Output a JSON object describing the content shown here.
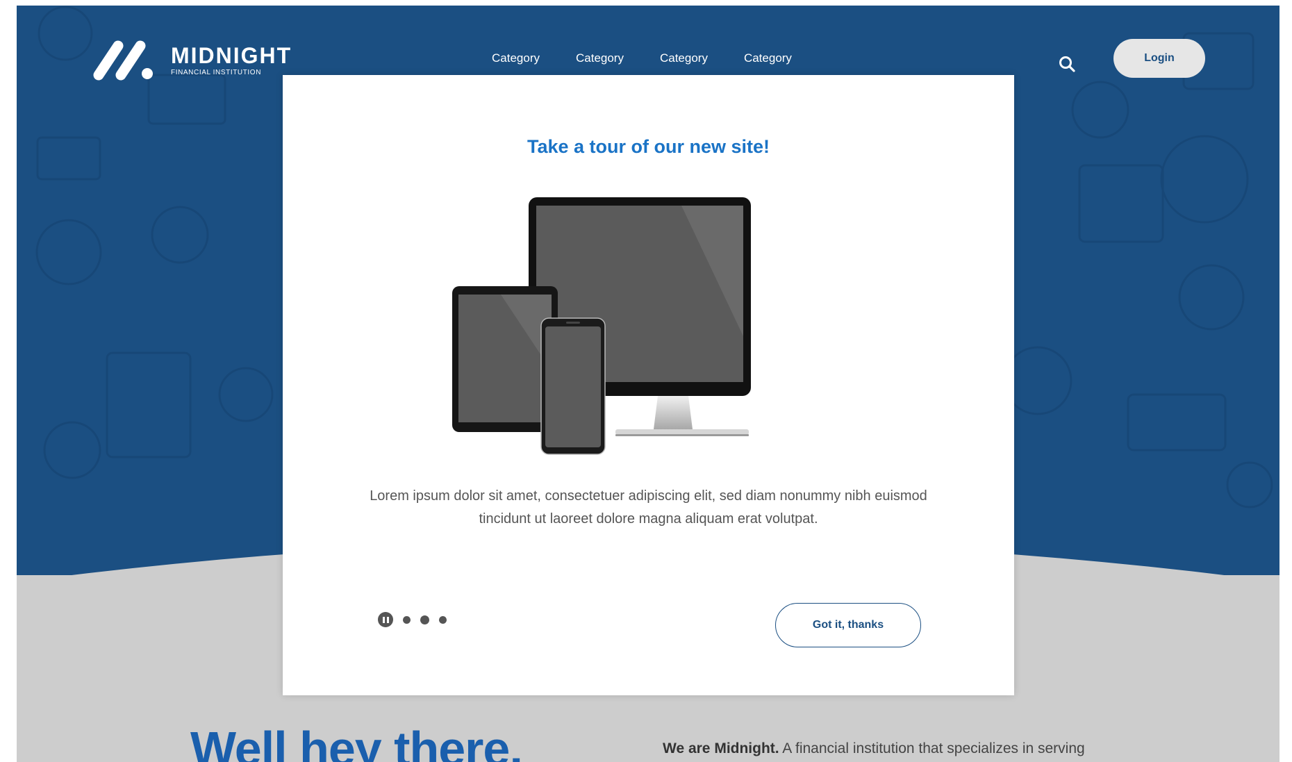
{
  "brand": {
    "name": "MIDNIGHT",
    "tagline": "FINANCIAL INSTITUTION",
    "color_primary": "#1b4f82",
    "color_accent": "#1a73c6"
  },
  "nav": {
    "items": [
      {
        "label": "Category"
      },
      {
        "label": "Category"
      },
      {
        "label": "Category"
      },
      {
        "label": "Category"
      }
    ],
    "search_icon": "search-icon",
    "login_label": "Login"
  },
  "modal": {
    "title": "Take a tour of our new site!",
    "illustration": "devices-illustration",
    "body": "Lorem ipsum dolor sit amet, consectetuer adipiscing elit, sed diam nonummy nibh euismod tincidunt ut laoreet dolore magna aliquam erat volutpat.",
    "carousel": {
      "total_slides": 3,
      "active_slide": 1,
      "pause_icon": "pause-icon"
    },
    "confirm_label": "Got it, thanks"
  },
  "intro": {
    "heading": "Well hey there,",
    "lead_bold": "We are Midnight.",
    "lead_text": " A financial institution that specializes in serving"
  }
}
